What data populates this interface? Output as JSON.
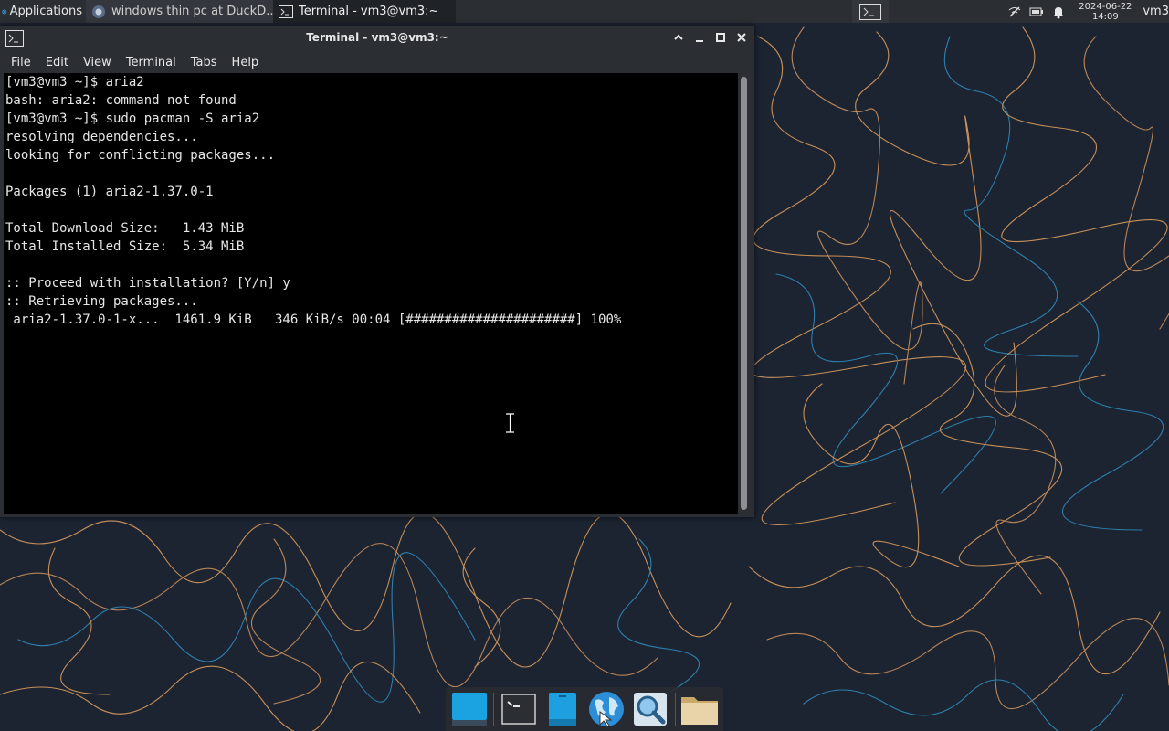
{
  "top_panel": {
    "applications_label": "Applications",
    "tasks": [
      {
        "label": "windows thin pc at DuckD...",
        "icon": "browser-icon"
      },
      {
        "label": "Terminal - vm3@vm3:~",
        "icon": "terminal-icon"
      }
    ],
    "clock": {
      "date": "2024-06-22",
      "time": "14:09"
    },
    "username": "vm3"
  },
  "window": {
    "title": "Terminal - vm3@vm3:~",
    "menu": [
      "File",
      "Edit",
      "View",
      "Terminal",
      "Tabs",
      "Help"
    ]
  },
  "terminal": {
    "lines": [
      "[vm3@vm3 ~]$ aria2",
      "bash: aria2: command not found",
      "[vm3@vm3 ~]$ sudo pacman -S aria2",
      "resolving dependencies...",
      "looking for conflicting packages...",
      "",
      "Packages (1) aria2-1.37.0-1",
      "",
      "Total Download Size:   1.43 MiB",
      "Total Installed Size:  5.34 MiB",
      "",
      ":: Proceed with installation? [Y/n] y",
      ":: Retrieving packages...",
      " aria2-1.37.0-1-x...  1461.9 KiB   346 KiB/s 00:04 [######################] 100%"
    ]
  },
  "dock": {
    "items": [
      "desktop-icon",
      "terminal-icon",
      "file-manager-icon",
      "web-browser-icon",
      "app-finder-icon",
      "folder-icon"
    ]
  },
  "colors": {
    "panel_bg": "#2b2e33",
    "terminal_bg": "#000000",
    "terminal_fg": "#e6e6e6",
    "wallpaper_bg": "#1b2430",
    "wallpaper_line_orange": "#c8905a",
    "wallpaper_line_blue": "#2f7fae"
  }
}
